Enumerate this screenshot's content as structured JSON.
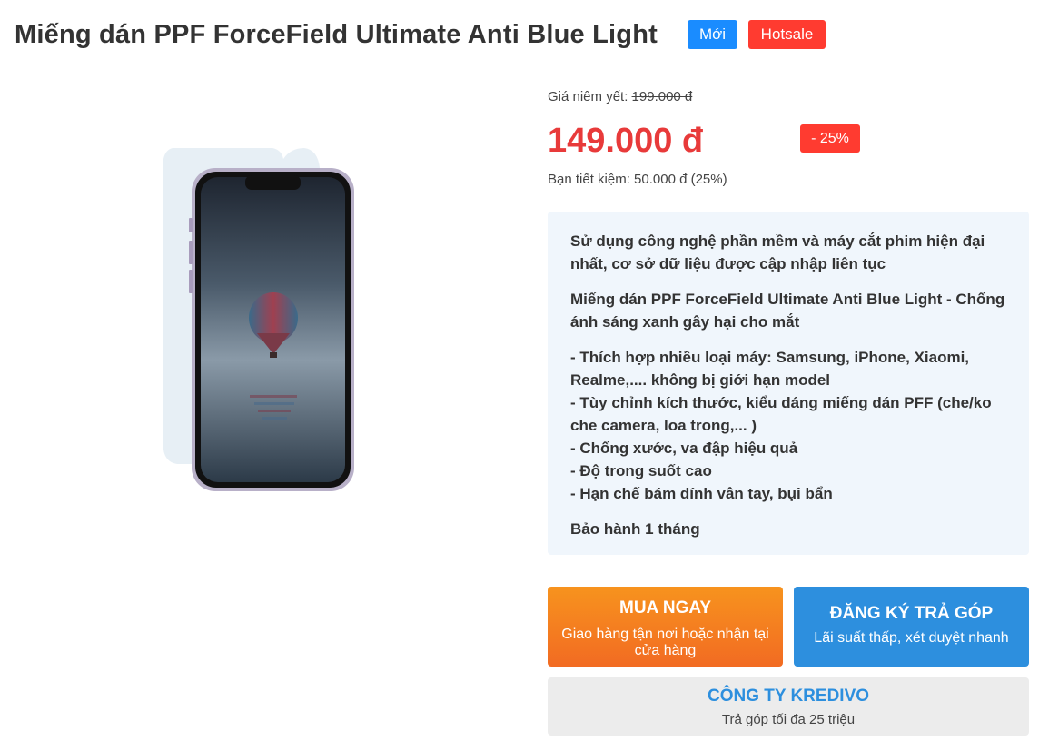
{
  "product": {
    "title": "Miếng dán PPF ForceField Ultimate Anti Blue Light",
    "badges": {
      "new": "Mới",
      "hot": "Hotsale"
    }
  },
  "pricing": {
    "list_label": "Giá niêm yết:",
    "list_price": "199.000 đ",
    "sale_price": "149.000 đ",
    "discount": "- 25%",
    "savings": "Bạn tiết kiệm: 50.000 đ (25%)"
  },
  "description": {
    "intro": "Sử dụng công nghệ phần mềm và máy cắt phim hiện đại nhất, cơ sở dữ liệu được cập nhập liên tục",
    "headline": "Miếng dán PPF ForceField Ultimate Anti Blue Light - Chống ánh sáng xanh gây hại cho mắt",
    "features": [
      "- Thích hợp nhiều loại máy: Samsung, iPhone, Xiaomi, Realme,.... không bị giới hạn model",
      "- Tùy chỉnh kích thước, kiểu dáng miếng dán PFF (che/ko che camera, loa trong,... )",
      "- Chống xước, va đập hiệu quả",
      "- Độ trong suốt cao",
      "- Hạn chế bám dính vân tay, bụi bẩn"
    ],
    "warranty": "Bảo hành 1 tháng"
  },
  "actions": {
    "buy": {
      "label": "MUA NGAY",
      "sub": "Giao hàng tận nơi hoặc nhận tại cửa hàng"
    },
    "installment": {
      "label": "ĐĂNG KÝ TRẢ GÓP",
      "sub": "Lãi suất thấp, xét duyệt nhanh"
    },
    "kredivo": {
      "label": "CÔNG TY KREDIVO",
      "sub": "Trả góp tối đa 25 triệu"
    }
  },
  "colors": {
    "accent_red": "#e83a3a",
    "accent_blue": "#2d8fde",
    "accent_orange": "#f7931e",
    "badge_blue": "#1a8cff"
  }
}
